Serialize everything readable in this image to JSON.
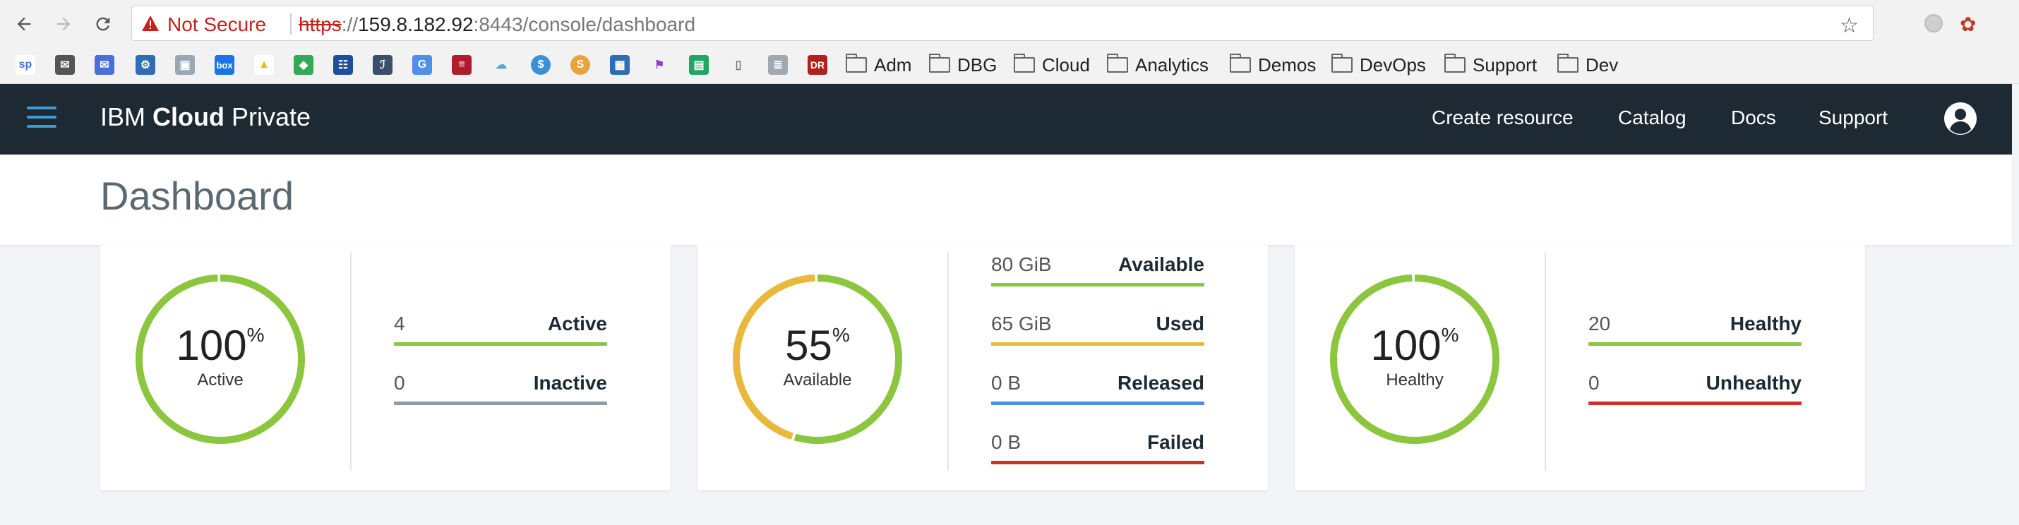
{
  "browser": {
    "security_label": "Not Secure",
    "url_scheme": "https",
    "url_sep": "://",
    "url_host": "159.8.182.92",
    "url_rest": ":8443/console/dashboard",
    "bookmark_folders": [
      "Adm",
      "DBG",
      "Cloud",
      "Analytics",
      "Demos",
      "DevOps",
      "Support",
      "Dev"
    ]
  },
  "app": {
    "brand_prefix": "IBM ",
    "brand_bold": "Cloud",
    "brand_suffix": " Private",
    "nav": [
      "Create resource",
      "Catalog",
      "Docs",
      "Support"
    ]
  },
  "page": {
    "title": "Dashboard"
  },
  "cards": [
    {
      "percent": "100",
      "percent_sign": "%",
      "label": "Active",
      "segments": [
        {
          "fraction": 1.0,
          "color": "#8cc63f"
        }
      ],
      "stats": [
        {
          "value": "4",
          "label": "Active",
          "color": "#8cc63f"
        },
        {
          "value": "0",
          "label": "Inactive",
          "color": "#8c9ba5"
        }
      ]
    },
    {
      "percent": "55",
      "percent_sign": "%",
      "label": "Available",
      "segments": [
        {
          "fraction": 0.55,
          "color": "#8cc63f"
        },
        {
          "fraction": 0.45,
          "color": "#e8b93d"
        }
      ],
      "stats": [
        {
          "value": "80 GiB",
          "label": "Available",
          "color": "#8cc63f"
        },
        {
          "value": "65 GiB",
          "label": "Used",
          "color": "#e8b93d"
        },
        {
          "value": "0 B",
          "label": "Released",
          "color": "#4a90e2"
        },
        {
          "value": "0 B",
          "label": "Failed",
          "color": "#d12e2e"
        }
      ]
    },
    {
      "percent": "100",
      "percent_sign": "%",
      "label": "Healthy",
      "segments": [
        {
          "fraction": 1.0,
          "color": "#8cc63f"
        }
      ],
      "stats": [
        {
          "value": "20",
          "label": "Healthy",
          "color": "#8cc63f"
        },
        {
          "value": "0",
          "label": "Unhealthy",
          "color": "#d12e2e"
        }
      ]
    }
  ],
  "colors": {
    "header_bg": "#1d2933",
    "accent": "#3d9bd9"
  }
}
